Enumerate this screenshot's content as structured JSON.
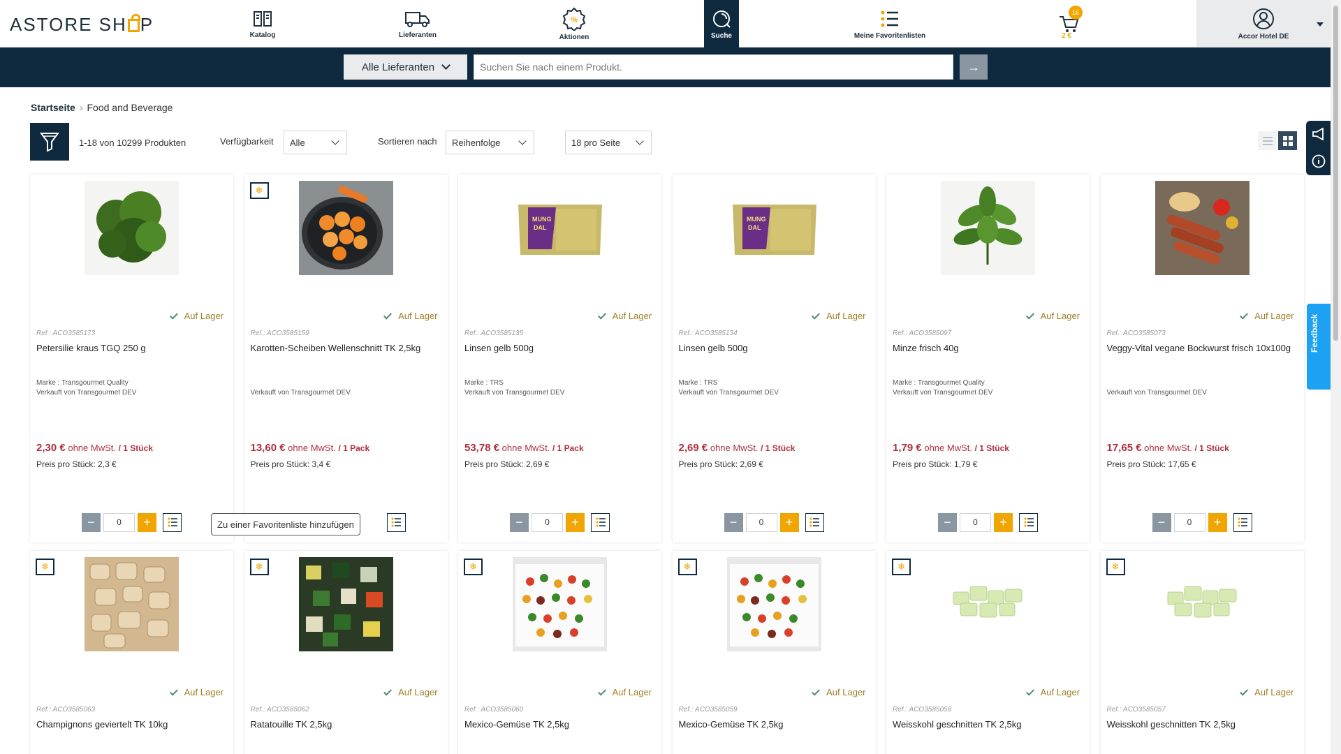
{
  "header": {
    "logo": "ASTORE SHOP",
    "nav": [
      {
        "label": "Katalog",
        "icon": "catalog-icon"
      },
      {
        "label": "Lieferanten",
        "icon": "truck-icon"
      },
      {
        "label": "Aktionen",
        "icon": "promo-badge-icon"
      },
      {
        "label": "Suche",
        "icon": "search-icon",
        "active": true
      },
      {
        "label": "Meine Favoritenlisten",
        "icon": "favorite-list-icon"
      }
    ],
    "cart": {
      "badge": "16",
      "total": "2 €"
    },
    "account_label": "Accor Hotel DE"
  },
  "search": {
    "supplier_select": "Alle Lieferanten",
    "placeholder": "Suchen Sie nach einem Produkt.",
    "submit": "→"
  },
  "breadcrumb": {
    "home": "Startseite",
    "current": "Food and Beverage"
  },
  "toolbar": {
    "result_count": "1-18 von 10299 Produkten",
    "availability_label": "Verfügbarkeit",
    "availability_value": "Alle",
    "sort_label": "Sortieren nach",
    "sort_value": "Reihenfolge",
    "per_page_value": "18 pro Seite"
  },
  "tooltip": "Zu einer Favoritenliste hinzufügen",
  "side": {
    "feedback": "Feedback"
  },
  "colors": {
    "navy": "#0f2a3e",
    "accent": "#f0a500",
    "price": "#b0303c"
  },
  "products": [
    {
      "ref": "Ref.: ACO3585173",
      "name": "Petersilie kraus TGQ 250 g",
      "brand": "Marke : Transgourmet Quality",
      "seller": "Verkauft von Transgourmet DEV",
      "price": "2,30 €",
      "tax": "ohne MwSt.",
      "unit": "/ 1 Stück",
      "unit_price": "Preis pro Stück: 2,3 €",
      "stock": "Auf Lager",
      "qty": "0",
      "frozen": false,
      "image": "parsley"
    },
    {
      "ref": "Ref.: ACO3585159",
      "name": "Karotten-Scheiben Wellenschnitt TK 2,5kg",
      "brand": "",
      "seller": "Verkauft von Transgourmet DEV",
      "price": "13,60 €",
      "tax": "ohne MwSt.",
      "unit": "/ 1 Pack",
      "unit_price": "Preis pro Stück: 3,4 €",
      "stock": "Auf Lager",
      "qty": "0",
      "frozen": true,
      "image": "carrots"
    },
    {
      "ref": "Ref.: ACO3585135",
      "name": "Linsen gelb 500g",
      "brand": "Marke : TRS",
      "seller": "Verkauft von Transgourmet DEV",
      "price": "53,78 €",
      "tax": "ohne MwSt.",
      "unit": "/ 1 Pack",
      "unit_price": "Preis pro Stück: 2,69 €",
      "stock": "Auf Lager",
      "qty": "0",
      "frozen": false,
      "image": "lentils"
    },
    {
      "ref": "Ref.: ACO3585134",
      "name": "Linsen gelb 500g",
      "brand": "Marke : TRS",
      "seller": "Verkauft von Transgourmet DEV",
      "price": "2,69 €",
      "tax": "ohne MwSt.",
      "unit": "/ 1 Stück",
      "unit_price": "Preis pro Stück: 2,69 €",
      "stock": "Auf Lager",
      "qty": "0",
      "frozen": false,
      "image": "lentils"
    },
    {
      "ref": "Ref.: ACO3585097",
      "name": "Minze frisch 40g",
      "brand": "Marke : Transgourmet Quality",
      "seller": "Verkauft von Transgourmet DEV",
      "price": "1,79 €",
      "tax": "ohne MwSt.",
      "unit": "/ 1 Stück",
      "unit_price": "Preis pro Stück: 1,79 €",
      "stock": "Auf Lager",
      "qty": "0",
      "frozen": false,
      "image": "mint"
    },
    {
      "ref": "Ref.: ACO3585073",
      "name": "Veggy-Vital vegane Bockwurst frisch 10x100g",
      "brand": "",
      "seller": "Verkauft von Transgourmet DEV",
      "price": "17,65 €",
      "tax": "ohne MwSt.",
      "unit": "/ 1 Stück",
      "unit_price": "Preis pro Stück: 17,65 €",
      "stock": "Auf Lager",
      "qty": "0",
      "frozen": false,
      "image": "sausages"
    },
    {
      "ref": "Ref.: ACO3585063",
      "name": "Champignons geviertelt TK 10kg",
      "stock": "Auf Lager",
      "frozen": true,
      "image": "mushrooms"
    },
    {
      "ref": "Ref.: ACO3585062",
      "name": "Ratatouille TK 2,5kg",
      "stock": "Auf Lager",
      "frozen": true,
      "image": "ratatouille"
    },
    {
      "ref": "Ref.: ACO3585060",
      "name": "Mexico-Gemüse TK 2,5kg",
      "stock": "Auf Lager",
      "frozen": true,
      "image": "mexico"
    },
    {
      "ref": "Ref.: ACO3585059",
      "name": "Mexico-Gemüse TK 2,5kg",
      "stock": "Auf Lager",
      "frozen": true,
      "image": "mexico"
    },
    {
      "ref": "Ref.: ACO3585058",
      "name": "Weisskohl geschnitten TK 2,5kg",
      "stock": "Auf Lager",
      "frozen": true,
      "image": "cabbage"
    },
    {
      "ref": "Ref.: ACO3585057",
      "name": "Weisskohl geschnitten TK 2,5kg",
      "stock": "Auf Lager",
      "frozen": true,
      "image": "cabbage"
    }
  ]
}
